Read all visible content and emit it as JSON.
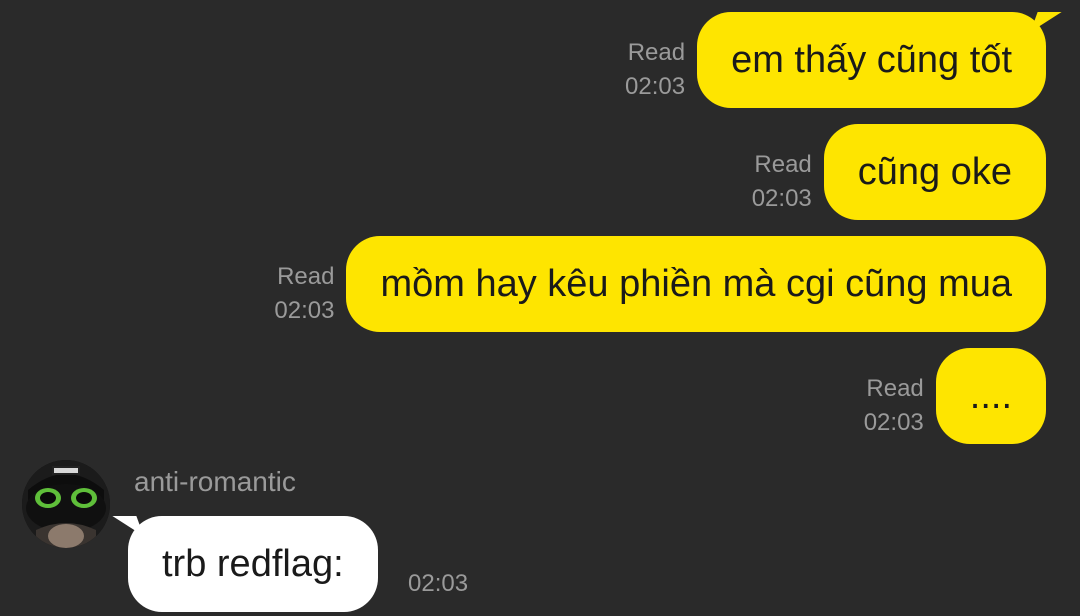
{
  "messages_out": [
    {
      "text": "em thấy cũng tốt",
      "read": "Read",
      "time": "02:03"
    },
    {
      "text": "cũng oke",
      "read": "Read",
      "time": "02:03"
    },
    {
      "text": "mồm hay kêu phiền mà cgi cũng mua",
      "read": "Read",
      "time": "02:03"
    },
    {
      "text": "....",
      "read": "Read",
      "time": "02:03"
    }
  ],
  "message_in": {
    "sender": "anti-romantic",
    "text": "trb redflag:",
    "time": "02:03",
    "avatar_icon": "black-cat-avatar"
  },
  "colors": {
    "background": "#2a2a2a",
    "outgoing_bubble": "#fee500",
    "incoming_bubble": "#ffffff",
    "meta_text": "#9a9a9a"
  }
}
